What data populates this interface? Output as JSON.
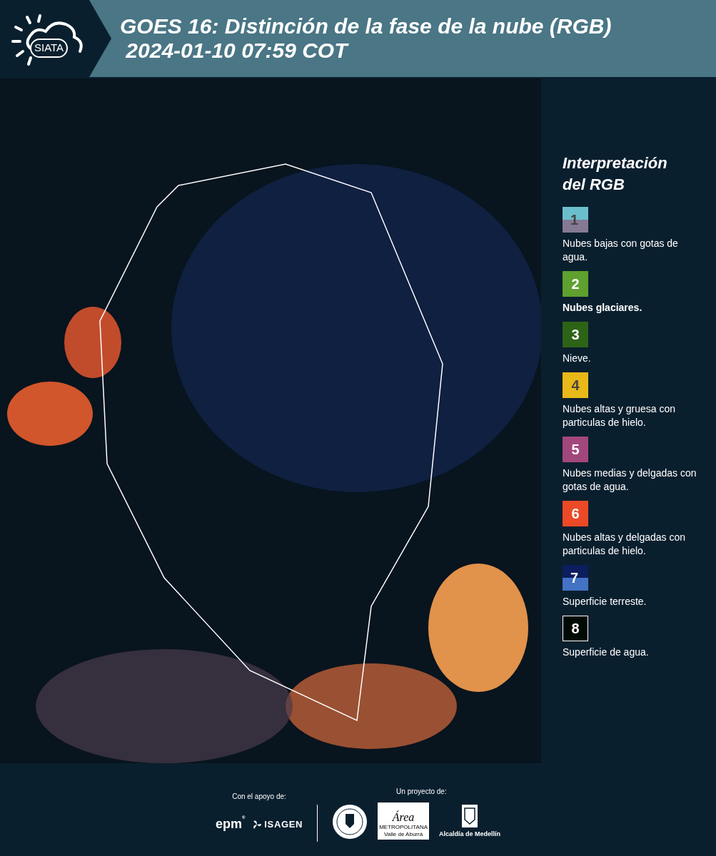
{
  "header": {
    "logo_text": "SIATA",
    "title_line1": "GOES 16: Distinción de la fase de la nube (RGB)",
    "title_line2": " 2024-01-10 07:59 COT"
  },
  "legend": {
    "title_line1": "Interpretación",
    "title_line2": "del RGB",
    "items": [
      {
        "number": "1",
        "bands": [
          {
            "color": "#6bbfcc"
          },
          {
            "color": "#857a94"
          }
        ],
        "label": "Nubes bajas con gotas de agua.",
        "bold": false
      },
      {
        "number": "2",
        "bands": [
          {
            "color": "#5ea12e"
          }
        ],
        "label": "Nubes glaciares.",
        "bold": true
      },
      {
        "number": "3",
        "bands": [
          {
            "color": "#2d6317"
          }
        ],
        "label": "Nieve.",
        "bold": false
      },
      {
        "number": "4",
        "bands": [
          {
            "color": "#e8b918"
          }
        ],
        "label": "Nubes altas y gruesa con particulas de hielo.",
        "bold": false
      },
      {
        "number": "5",
        "bands": [
          {
            "color": "#a2477c"
          }
        ],
        "label": "Nubes medias y delgadas con gotas de agua.",
        "bold": false
      },
      {
        "number": "6",
        "bands": [
          {
            "color": "#ec4a26"
          }
        ],
        "label": "Nubes altas y delgadas con particulas de hielo.",
        "bold": false
      },
      {
        "number": "7",
        "bands": [
          {
            "color": "#0c1e5e"
          },
          {
            "color": "#4472c4"
          }
        ],
        "label": "Superficie terreste.",
        "bold": false
      },
      {
        "number": "8",
        "bands": [
          {
            "color": "#000a05"
          }
        ],
        "label": "Superficie de agua.",
        "bold": false
      }
    ]
  },
  "footer": {
    "support_label": "Con el apoyo de:",
    "project_label": "Un proyecto de:",
    "epm": "epm",
    "registered": "®",
    "isagen": "ISAGEN",
    "area": "Área",
    "metropolitana": "METROPOLITANA",
    "valle": "Valle de Aburrá",
    "alcaldia": "Alcaldía de Medellín"
  }
}
